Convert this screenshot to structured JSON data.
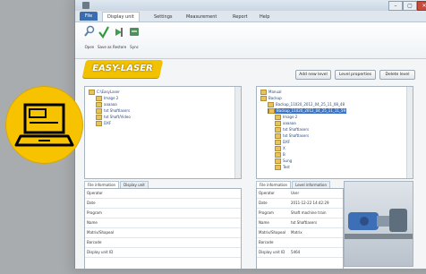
{
  "ribbon_tabs": [
    "File",
    "Display unit",
    "Settings",
    "Measurement",
    "Report",
    "Help"
  ],
  "active_tab_index": 1,
  "ribbon_buttons": [
    "Open",
    "Save as",
    "Restore",
    "Sync"
  ],
  "logo_text": "EASY-LASER",
  "toolbar_buttons": [
    "Add new level",
    "Level properties",
    "Delete level"
  ],
  "left_tree": [
    {
      "label": "C:\\EasyLaser",
      "depth": 0
    },
    {
      "label": "Image 2",
      "depth": 1
    },
    {
      "label": "aaaaaa",
      "depth": 1
    },
    {
      "label": "txt Shaftlasers",
      "depth": 1
    },
    {
      "label": "txt Shaft/Video",
      "depth": 1
    },
    {
      "label": "DXF",
      "depth": 1
    }
  ],
  "right_tree": [
    {
      "label": "Manual",
      "depth": 0
    },
    {
      "label": "Backup",
      "depth": 0
    },
    {
      "label": "Backup_11020_2012_04_25_11_08_48",
      "depth": 1
    },
    {
      "label": "Backup_11020_2012_04_25_11_11_59",
      "depth": 1,
      "highlight": true
    },
    {
      "label": "Image 2",
      "depth": 2
    },
    {
      "label": "aaaaaa",
      "depth": 2
    },
    {
      "label": "txt Shaftlasers",
      "depth": 2
    },
    {
      "label": "txt Shaftlasers",
      "depth": 2
    },
    {
      "label": "DXF",
      "depth": 2
    },
    {
      "label": "X",
      "depth": 2
    },
    {
      "label": "B",
      "depth": 2
    },
    {
      "label": "Sung",
      "depth": 2
    },
    {
      "label": "Test",
      "depth": 2
    }
  ],
  "left_info_tabs": [
    "File information",
    "Display unit"
  ],
  "right_info_tabs": [
    "File information",
    "Level information"
  ],
  "left_info_rows": [
    {
      "key": "Operator",
      "value": ""
    },
    {
      "key": "Date",
      "value": ""
    },
    {
      "key": "Program",
      "value": ""
    },
    {
      "key": "Name",
      "value": ""
    },
    {
      "key": "Matrix/Shapeal",
      "value": ""
    },
    {
      "key": "Barcode",
      "value": ""
    },
    {
      "key": "Display unit ID",
      "value": ""
    }
  ],
  "right_info_rows": [
    {
      "key": "Operator",
      "value": "User"
    },
    {
      "key": "Date",
      "value": "2011-12-22 14:42:29"
    },
    {
      "key": "Program",
      "value": "Shaft machine train"
    },
    {
      "key": "Name",
      "value": "txt Shaftlasers"
    },
    {
      "key": "Matrix/Shapeal",
      "value": "Matrix"
    },
    {
      "key": "Barcode",
      "value": ""
    },
    {
      "key": "Display unit ID",
      "value": "5464"
    }
  ],
  "colors": {
    "brand_yellow": "#f7c300",
    "selection_blue": "#3d75c8",
    "file_tab_blue": "#3a6db0"
  }
}
